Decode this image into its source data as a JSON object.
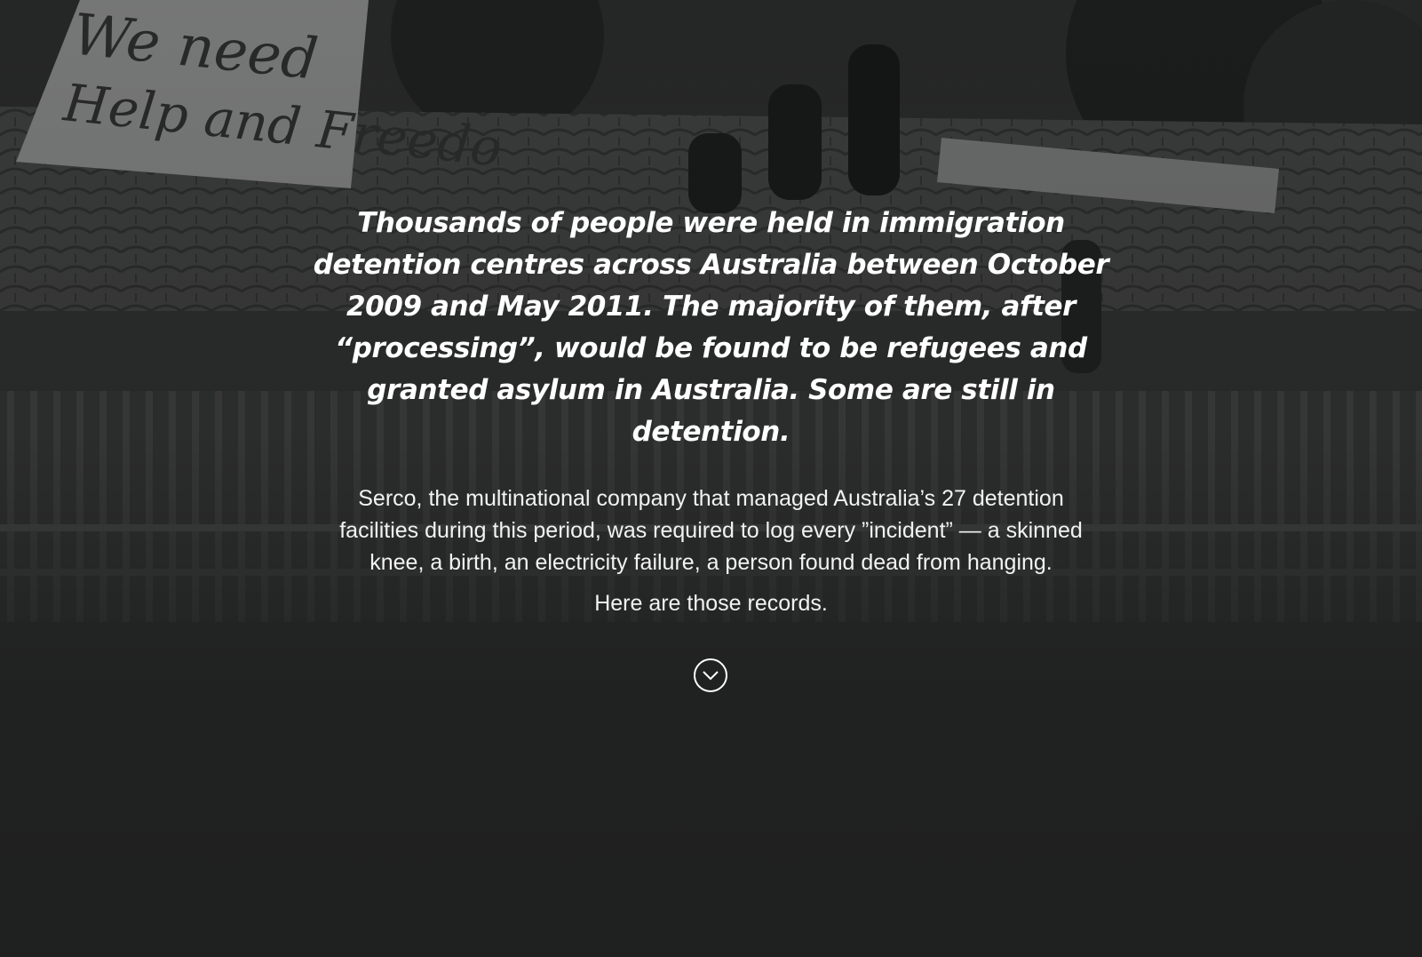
{
  "hero": {
    "background_image": "rooftop-protest-photo",
    "lead": "Thousands of people were held in immigration detention centres across Australia between October 2009 and May 2011. The majority of them, after “processing”, would be found to be refugees and granted asylum in Australia. Some are still in detention.",
    "body": "Serco, the multinational company that managed Australia’s 27 detention facilities during this period, was required to log every ”incident” — a skinned knee, a birth, an electricity failure, a person found dead from hanging.",
    "closing": "Here are those records.",
    "banner_text": "We need Help and Freedom",
    "scroll_icon": "chevron-down-circle-icon"
  },
  "colors": {
    "text": "#ffffff",
    "background": "#1f2020"
  }
}
